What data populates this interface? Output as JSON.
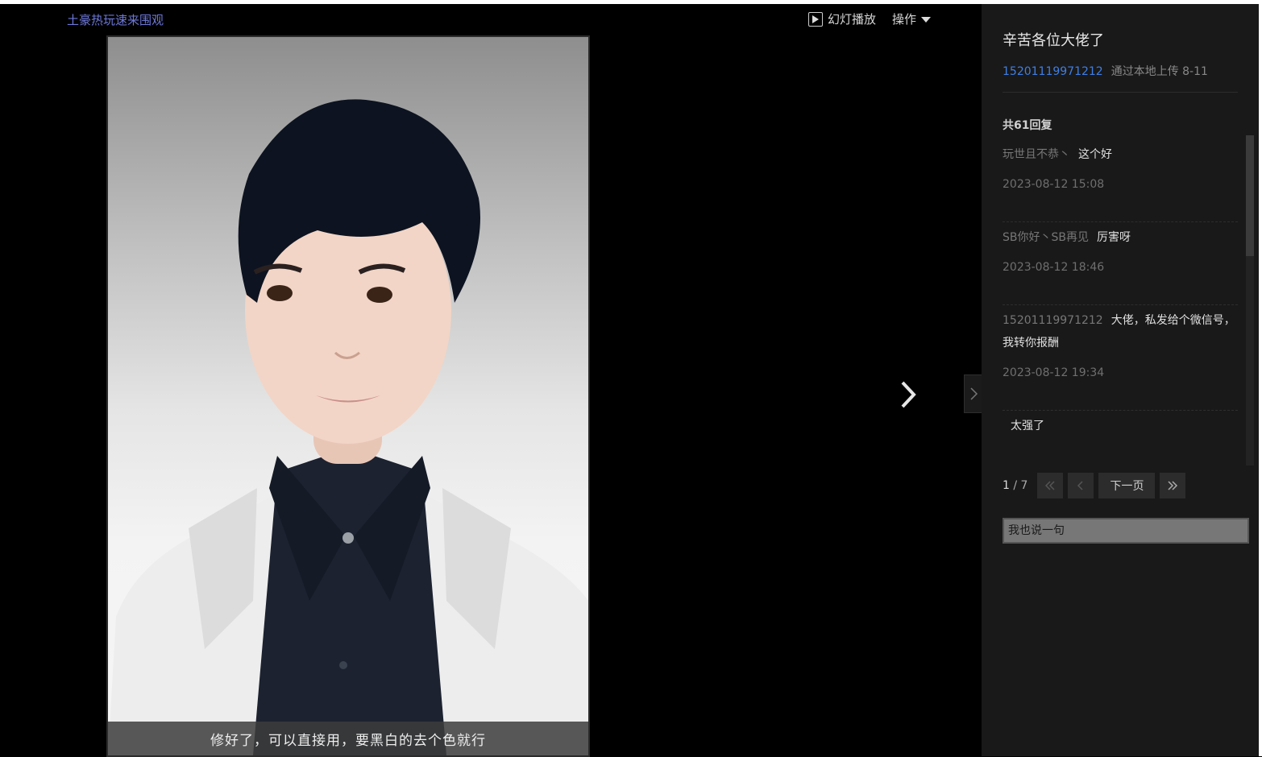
{
  "viewer": {
    "album_link": "土豪热玩速来围观",
    "toolbar": {
      "slideshow_label": "幻灯播放",
      "actions_label": "操作"
    },
    "photo_caption": "修好了，可以直接用，要黑白的去个色就行"
  },
  "panel": {
    "post_title": "辛苦各位大佬了",
    "author": "15201119971212",
    "upload_info": "通过本地上传 8-11",
    "reply_count_label": "共61回复",
    "replies": [
      {
        "user": "玩世且不恭丶",
        "text": "这个好",
        "time": "2023-08-12 15:08"
      },
      {
        "user": "SB你好丶SB再见",
        "text": "厉害呀",
        "time": "2023-08-12 18:46"
      },
      {
        "user": "15201119971212",
        "text": "大佬，私发给个微信号，我转你报酬",
        "time": "2023-08-12 19:34"
      },
      {
        "user": "",
        "text": "太强了",
        "time": ""
      }
    ],
    "pagination": {
      "current": "1",
      "total": "/ 7",
      "next_label": "下一页"
    },
    "comment_placeholder": "我也说一句"
  },
  "colors": {
    "link_blue": "#3f7fe6",
    "album_link": "#6d78d9",
    "panel_bg": "#191919"
  },
  "icons": [
    "play-icon",
    "caret-down-icon",
    "chevron-right-icon",
    "first-page-icon",
    "prev-page-icon",
    "last-page-icon"
  ]
}
